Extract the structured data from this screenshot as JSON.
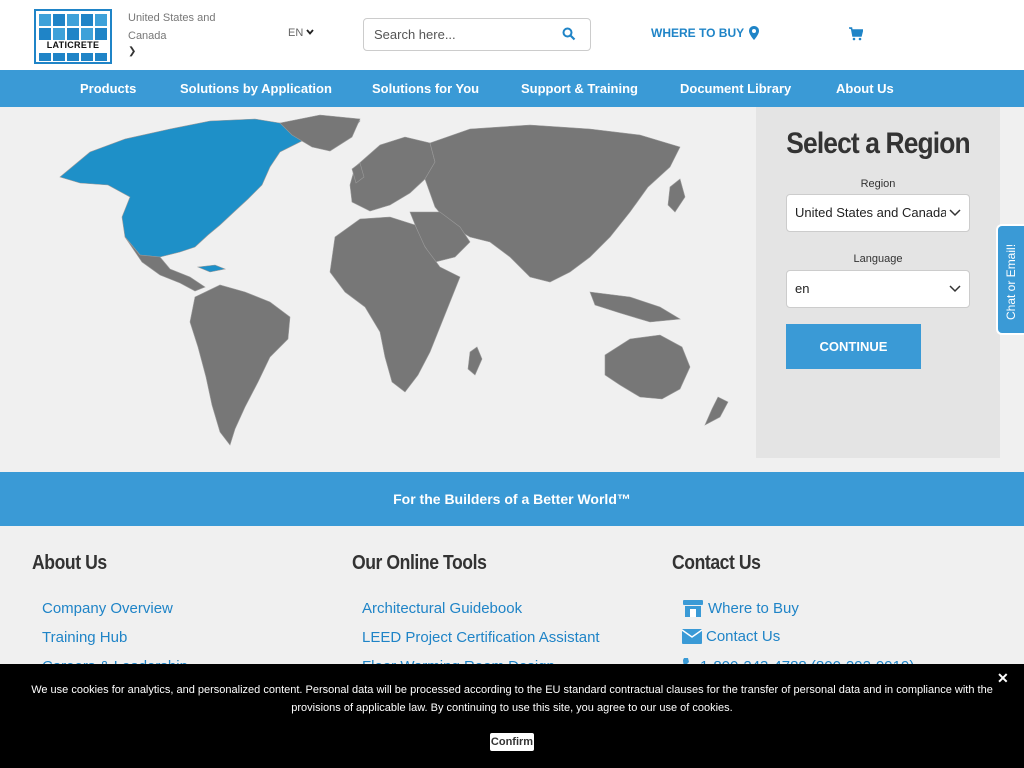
{
  "header": {
    "logo_text": "LATICRETE",
    "region": "United States and Canada",
    "language": "EN",
    "search_placeholder": "Search here...",
    "where_to_buy": "WHERE TO BUY"
  },
  "nav": {
    "items": [
      "Products",
      "Solutions by Application",
      "Solutions for You",
      "Support & Training",
      "Document Library",
      "About Us"
    ]
  },
  "region_panel": {
    "title": "Select a Region",
    "region_label": "Region",
    "region_value": "United States and Canada",
    "language_label": "Language",
    "language_value": "en",
    "continue_label": "CONTINUE"
  },
  "chat": {
    "label": "Chat or Email!"
  },
  "tagline": "For the Builders of a Better World™",
  "footer": {
    "about": {
      "title": "About Us",
      "links": [
        "Company Overview",
        "Training Hub",
        "Careers & Leadership"
      ]
    },
    "tools": {
      "title": "Our Online Tools",
      "links": [
        "Architectural Guidebook",
        "LEED Project Certification Assistant",
        "Floor Warming Room Design"
      ]
    },
    "contact": {
      "title": "Contact Us",
      "where_to_buy": "Where to Buy",
      "contact_us": "Contact Us",
      "phone": "1-800-243-4788 (800-292-9919)"
    }
  },
  "cookie": {
    "text": "We use cookies for analytics, and personalized content. Personal data will be processed according to the EU standard contractual clauses for the transfer of personal data and in compliance with the provisions of applicable law. By continuing to use this site, you agree to our use of cookies.",
    "close": "✕",
    "confirm": "Confirm"
  },
  "colors": {
    "brand_blue": "#3a9ad6",
    "link_blue": "#1f84c7",
    "map_gray": "#777777",
    "map_selected": "#1e90c8"
  }
}
